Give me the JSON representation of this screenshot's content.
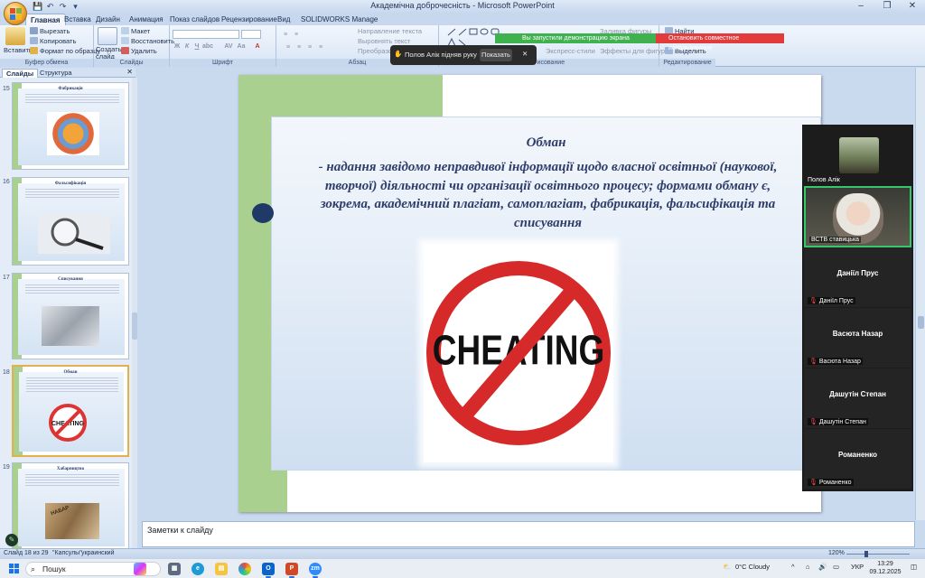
{
  "window": {
    "title": "Академічна доброчесність - Microsoft PowerPoint",
    "controls": [
      "–",
      "❐",
      "✕"
    ]
  },
  "quick_access": [
    "save-icon",
    "undo-icon",
    "redo-icon",
    "customize-icon"
  ],
  "ribbon": {
    "tabs": [
      "Главная",
      "Вставка",
      "Дизайн",
      "Анимация",
      "Показ слайдов",
      "Рецензирование",
      "Вид",
      "SOLIDWORKS Manage"
    ],
    "active_tab": "Главная",
    "clipboard": {
      "paste": "Вставить",
      "cut": "Вырезать",
      "copy": "Копировать",
      "format_painter": "Формат по образцу",
      "label": "Буфер обмена"
    },
    "slides": {
      "new_slide": "Создать слайд",
      "layout": "Макет",
      "reset": "Восстановить",
      "delete": "Удалить",
      "label": "Слайды"
    },
    "font": {
      "label": "Шрифт"
    },
    "paragraph": {
      "text_direction": "Направление текста",
      "align_text": "Выровнять текст",
      "convert": "Преобразовать",
      "label": "Абзац"
    },
    "drawing": {
      "quick_styles": "Экспресс-стили",
      "shape_fill": "Заливка фигуры",
      "shape_outline": "Контур фигуры",
      "shape_effects": "Эффекты для фигур",
      "arrange": "Упорядочить",
      "label": "Рисование"
    },
    "editing": {
      "find": "Найти",
      "select": "Выделить",
      "label": "Редактирование"
    }
  },
  "zoom_overlay": {
    "hand_raised_text": "Полов Алік підняв руку",
    "show_button": "Показать",
    "close": "✕",
    "demo_banner": "Вы запустили демонстрацию экрана",
    "stop_share": "Остановить совместное использование"
  },
  "left_panel": {
    "tabs": [
      "Слайды",
      "Структура"
    ],
    "close": "✕",
    "thumbnails": [
      {
        "num": "15",
        "title": "Фабрикація"
      },
      {
        "num": "16",
        "title": "Фальсифікація"
      },
      {
        "num": "17",
        "title": "Списування"
      },
      {
        "num": "18",
        "title": "Обман",
        "image_text": "CHEATING"
      },
      {
        "num": "19",
        "title": "Хабарництво",
        "image_text": "НАБАР"
      }
    ],
    "selected": "18"
  },
  "slide": {
    "title": "Обман",
    "body": "- надання завідомо неправдивої інформації щодо власної освітньої (наукової, творчої) діяльності чи організації освітнього процесу; формами обману є, зокрема, академічний плагіат, самоплагіат, фабрикація, фальсифікація та списування",
    "image_text": "CHEATING"
  },
  "participants": [
    {
      "name": "Полов Алік",
      "video": true,
      "hand_raised": true
    },
    {
      "name": "ВСТВ ставицька",
      "video": true,
      "active_speaker": true
    },
    {
      "name": "Даніїл Прус",
      "label": "Даніїл Прус",
      "muted": true
    },
    {
      "name": "Васюта Назар",
      "label": "Васюта Назар",
      "muted": true
    },
    {
      "name": "Дашутін Степан",
      "label": "Дашутін Степан",
      "muted": true
    },
    {
      "name": "Романенко",
      "label": "Романенко",
      "muted": true
    }
  ],
  "notes": {
    "placeholder": "Заметки к слайду"
  },
  "status": {
    "slide": "Слайд 18 из 29",
    "theme": "\"Капсулы\"",
    "language": "украинский",
    "zoom": "120%"
  },
  "taskbar": {
    "search": "Пошук",
    "weather": "0°C  Cloudy",
    "language": "УКР",
    "time": "13:29",
    "date": "09.12.2025"
  },
  "colors": {
    "accent_green": "#a9d08e",
    "title_text": "#2e3d6a",
    "zoom_green": "#3fb24f",
    "zoom_red": "#e23b3b"
  }
}
